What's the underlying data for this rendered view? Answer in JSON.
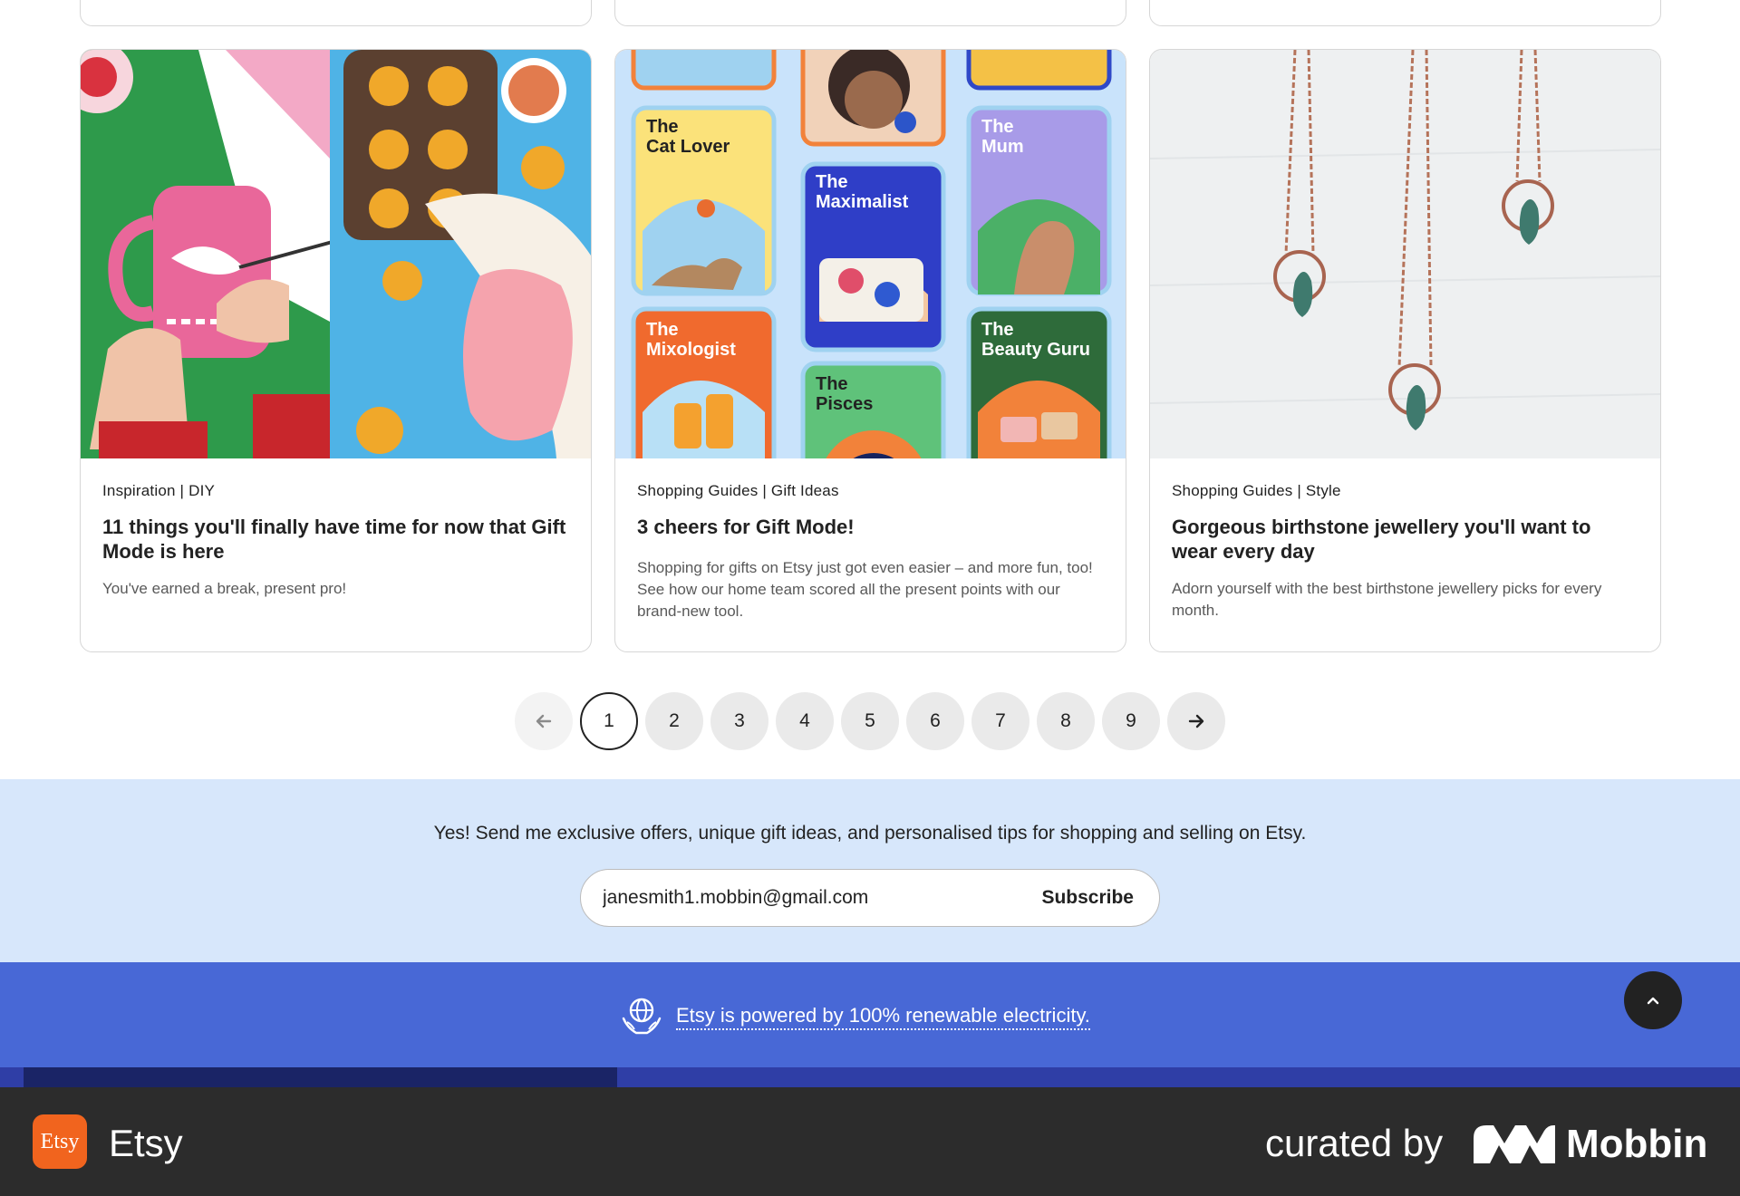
{
  "articles": [
    {
      "category": "Inspiration | DIY",
      "title": "11 things you'll finally have time for now that Gift Mode is here",
      "description": "You've earned a break, present pro!"
    },
    {
      "category": "Shopping Guides | Gift Ideas",
      "title": "3 cheers for Gift Mode!",
      "description": "Shopping for gifts on Etsy just got even easier – and more fun, too! See how our home team scored all the present points with our brand-new tool.",
      "image_tiles": {
        "cat_lover": [
          "The",
          "Cat Lover"
        ],
        "maximalist": [
          "The",
          "Maximalist"
        ],
        "mum": [
          "The",
          "Mum"
        ],
        "mixologist": [
          "The",
          "Mixologist"
        ],
        "pisces": [
          "The",
          "Pisces"
        ],
        "beauty_guru": [
          "The",
          "Beauty Guru"
        ]
      }
    },
    {
      "category": "Shopping Guides | Style",
      "title": "Gorgeous birthstone jewellery you'll want to wear every day",
      "description": "Adorn yourself with the best birthstone jewellery picks for every month."
    }
  ],
  "pagination": {
    "prev_icon": "arrow-left-icon",
    "next_icon": "arrow-right-icon",
    "pages": [
      "1",
      "2",
      "3",
      "4",
      "5",
      "6",
      "7",
      "8",
      "9"
    ],
    "current": "1"
  },
  "newsletter": {
    "message": "Yes! Send me exclusive offers, unique gift ideas, and personalised tips for shopping and selling on Etsy.",
    "email_value": "janesmith1.mobbin@gmail.com",
    "subscribe_label": "Subscribe"
  },
  "renewable": {
    "text": "Etsy is powered by 100% renewable electricity.",
    "icon": "globe-hands-icon"
  },
  "back_to_top_icon": "chevron-up-icon",
  "bottom_bar": {
    "app_icon_text": "Etsy",
    "app_name": "Etsy",
    "curated_by": "curated by",
    "brand": "Mobbin"
  },
  "colors": {
    "etsy_orange": "#f1641e",
    "newsletter_bg": "#d7e7fb",
    "renewable_bg": "#4868d6",
    "bottom_bar_bg": "#2c2c2c"
  }
}
